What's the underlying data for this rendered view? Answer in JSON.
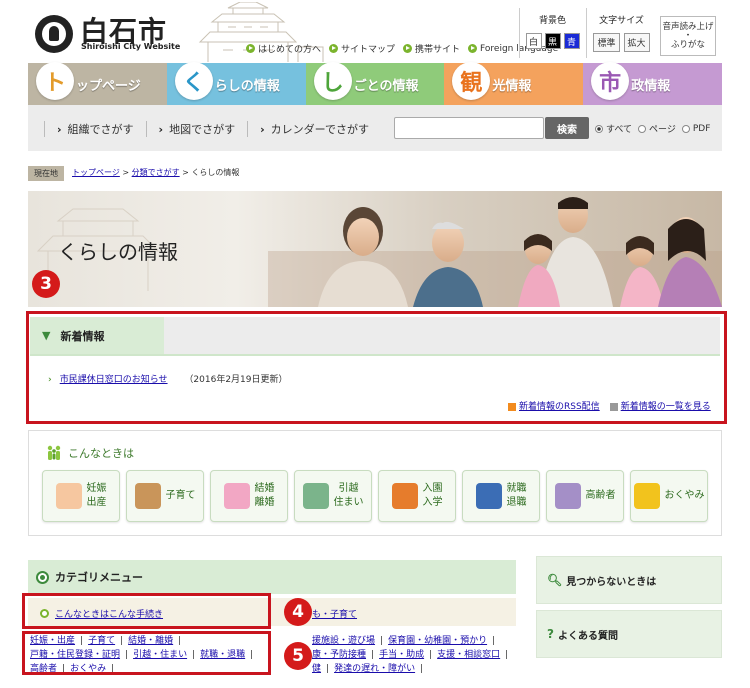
{
  "header": {
    "logo_name": "白石市",
    "logo_sub": "Shiroishi City Website",
    "top_links": [
      "はじめての方へ",
      "サイトマップ",
      "携帯サイト",
      "Foreign language"
    ],
    "bg_color_label": "背景色",
    "bg_colors": [
      {
        "label": "白",
        "bg": "#ffffff",
        "fg": "#222222"
      },
      {
        "label": "黒",
        "bg": "#000000",
        "fg": "#ffffff"
      },
      {
        "label": "青",
        "bg": "#1a2bd6",
        "fg": "#ffffff"
      }
    ],
    "font_size_label": "文字サイズ",
    "font_sizes": [
      "標準",
      "拡大"
    ],
    "voice_line1": "音声読み上げ",
    "voice_line2": "・",
    "voice_line3": "ふりがな"
  },
  "nav": [
    {
      "initial": "ト",
      "rest": "ップページ",
      "color": "#bdb5a3",
      "accent": "#e39b2b"
    },
    {
      "initial": "く",
      "rest": "らしの情報",
      "color": "#76c1de",
      "accent": "#2a96c8"
    },
    {
      "initial": "し",
      "rest": "ごとの情報",
      "color": "#8fcb7a",
      "accent": "#4ea53a"
    },
    {
      "initial": "観",
      "rest": "光情報",
      "color": "#f4a25d",
      "accent": "#e9731e"
    },
    {
      "initial": "市",
      "rest": "政情報",
      "color": "#c59ad2",
      "accent": "#9a58b4"
    }
  ],
  "search": {
    "links": [
      "組織でさがす",
      "地図でさがす",
      "カレンダーでさがす"
    ],
    "button_label": "検索",
    "options": [
      {
        "label": "すべて",
        "selected": true
      },
      {
        "label": "ページ",
        "selected": false
      },
      {
        "label": "PDF",
        "selected": false
      }
    ]
  },
  "breadcrumb": {
    "label": "現在地",
    "items": [
      "トップページ",
      "分類でさがす"
    ],
    "current": "くらしの情報",
    "sep": " > "
  },
  "hero": {
    "title": "くらしの情報"
  },
  "markers": [
    "3",
    "4",
    "5"
  ],
  "news": {
    "title": "新着情報",
    "items": [
      {
        "text": "市民課休日窓口のお知らせ",
        "date": "（2016年2月19日更新）"
      }
    ],
    "rss_label": "新着情報のRSS配信",
    "list_label": "新着情報の一覧を見る"
  },
  "konna": {
    "title": "こんなときは",
    "tiles": [
      {
        "name": "pregnancy",
        "l1": "妊娠",
        "l2": "出産",
        "icon_color": "#f6c7a0"
      },
      {
        "name": "childcare",
        "l1": "子育て",
        "l2": "",
        "icon_color": "#c9955a"
      },
      {
        "name": "marriage",
        "l1": "結婚",
        "l2": "離婚",
        "icon_color": "#f2a7c4"
      },
      {
        "name": "moving",
        "l1": "引越",
        "l2": "住まい",
        "icon_color": "#7bb48b"
      },
      {
        "name": "school",
        "l1": "入園",
        "l2": "入学",
        "icon_color": "#e67c2c"
      },
      {
        "name": "employment",
        "l1": "就職",
        "l2": "退職",
        "icon_color": "#3b6db5"
      },
      {
        "name": "elderly",
        "l1": "高齢者",
        "l2": "",
        "icon_color": "#a48fc7"
      },
      {
        "name": "condolence",
        "l1": "おくやみ",
        "l2": "",
        "icon_color": "#f2c31d"
      }
    ]
  },
  "category": {
    "title": "カテゴリメニュー",
    "item1": "こんなときはこんな手続き",
    "item2": "も・子育て",
    "left_links_row1": [
      "妊娠・出産",
      "子育て",
      "結婚・離婚"
    ],
    "left_links_row2": [
      "戸籍・住民登録・証明",
      "引越・住まい",
      "就職・退職"
    ],
    "left_links_row3": [
      "高齢者",
      "おくやみ"
    ],
    "right_links_row1": [
      "援施設・遊び場",
      "保育園・幼稚園・預かり"
    ],
    "right_links_row2": [
      "康・予防接種",
      "手当・助成",
      "支援・相談窓口"
    ],
    "right_links_row3": [
      "健",
      "発達の遅れ・障がい"
    ]
  },
  "side": {
    "notfound": "見つからないときは",
    "faq": "よくある質問"
  }
}
